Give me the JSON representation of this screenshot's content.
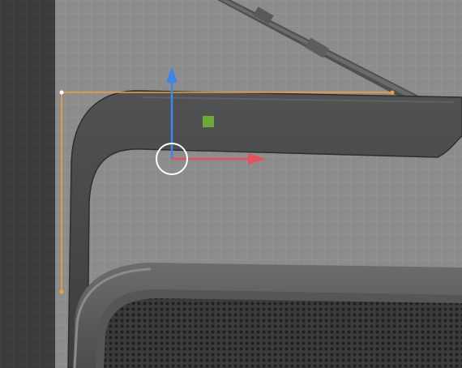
{
  "viewport": {
    "mode": "object-edit",
    "selection_color": "#f0a23a",
    "grid_background": "#8c8c8c",
    "side_panel_background": "#3b3b3b"
  },
  "gizmo": {
    "x_axis_color": "#e5525f",
    "z_axis_color": "#3f86e8",
    "center_color": "#6fa83a",
    "pivot_ring_color": "#ffffff"
  },
  "objects": [
    {
      "name": "handle",
      "color": "#444647"
    },
    {
      "name": "antenna",
      "color": "#505152"
    },
    {
      "name": "speaker-body",
      "color": "#5a5b5c"
    },
    {
      "name": "speaker-grille",
      "color": "#3b3c3d"
    }
  ]
}
